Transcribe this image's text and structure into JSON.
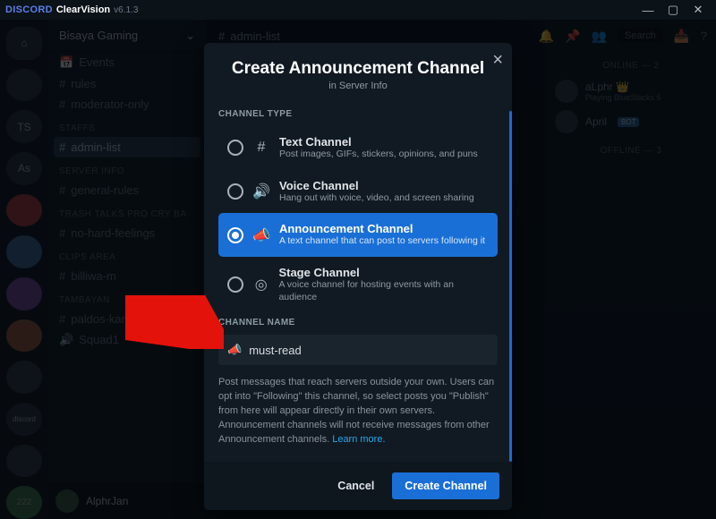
{
  "titlebar": {
    "brand": "DISCORD",
    "theme": "ClearVision",
    "version": "v6.1.3"
  },
  "server": {
    "name": "Bisaya Gaming"
  },
  "sidebar": {
    "sections": [
      {
        "label": "",
        "items": [
          "Events",
          "rules",
          "moderator-only"
        ]
      },
      {
        "label": "STAFFS",
        "items": [
          "admin-list"
        ]
      },
      {
        "label": "SERVER INFO",
        "items": [
          "general-rules"
        ]
      },
      {
        "label": "TRASH TALKS PRO CRY BA",
        "items": [
          "no-hard-feelings"
        ]
      },
      {
        "label": "CLIPS AREA",
        "items": [
          "billiwa-m"
        ]
      },
      {
        "label": "TAMBAYAN",
        "items": [
          "paldos-kantrol"
        ]
      },
      {
        "label": "",
        "items": [
          "Squad1"
        ]
      }
    ],
    "active": "admin-list",
    "user": "AlphrJan"
  },
  "main_tab": "admin-list",
  "tools": {
    "search": "Search"
  },
  "members": {
    "online_label": "ONLINE — 2",
    "offline_label": "OFFLINE — 3",
    "list": [
      {
        "name": "aLphr",
        "sub": "Playing BlueStacks 5",
        "crown": true
      },
      {
        "name": "April",
        "badge": "BOT"
      }
    ]
  },
  "modal": {
    "title": "Create Announcement Channel",
    "subtitle": "in Server Info",
    "type_label": "CHANNEL TYPE",
    "options": [
      {
        "key": "text",
        "name": "Text Channel",
        "desc": "Post images, GIFs, stickers, opinions, and puns",
        "glyph": "#"
      },
      {
        "key": "voice",
        "name": "Voice Channel",
        "desc": "Hang out with voice, video, and screen sharing",
        "glyph": "🔊"
      },
      {
        "key": "announcement",
        "name": "Announcement Channel",
        "desc": "A text channel that can post to servers following it",
        "glyph": "📣",
        "selected": true
      },
      {
        "key": "stage",
        "name": "Stage Channel",
        "desc": "A voice channel for hosting events with an audience",
        "glyph": "◎"
      }
    ],
    "name_label": "CHANNEL NAME",
    "name_value": "must-read",
    "help": "Post messages that reach servers outside your own. Users can opt into \"Following\" this channel, so select posts you \"Publish\" from here will appear directly in their own servers. Announcement channels will not receive messages from other Announcement channels. ",
    "learn_more": "Learn more.",
    "cancel": "Cancel",
    "create": "Create Channel"
  },
  "guilds": [
    "⌂",
    "",
    "TS",
    "As",
    "",
    "",
    "",
    "",
    "",
    "discord",
    "",
    "222"
  ]
}
